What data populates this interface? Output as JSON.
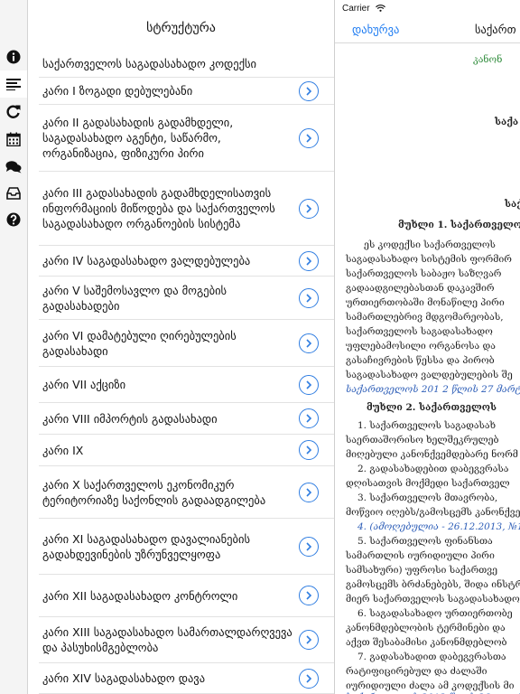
{
  "status_bar": {
    "carrier": "Carrier"
  },
  "rail": {
    "items": [
      {
        "icon": "info-icon"
      },
      {
        "icon": "structure-icon",
        "active": true
      },
      {
        "icon": "refresh-icon"
      },
      {
        "icon": "calendar-icon"
      },
      {
        "icon": "comments-icon"
      },
      {
        "icon": "inbox-icon"
      },
      {
        "icon": "help-icon"
      }
    ]
  },
  "panel": {
    "title": "სტრუქტურა",
    "items": [
      {
        "label": "საქართველოს საგადასახადო კოდექსი",
        "chevron": false
      },
      {
        "label": "კარი I ზოგადი დებულებანი",
        "chevron": true
      },
      {
        "label": "კარი II გადასახადის გადამხდელი, საგადასახადო აგენტი, საწარმო, ორგანიზაცია, ფიზიკური პირი",
        "chevron": true
      },
      {
        "label": "კარი III გადასახადის გადამხდელისათვის ინფორმაციის მიწოდება და საქართველოს საგადასახადო ორგანოების სისტემა",
        "chevron": true
      },
      {
        "label": "კარი IV საგადასახადო ვალდებულება",
        "chevron": true
      },
      {
        "label": "კარი V საშემოსავლო და მოგების გადასახადები",
        "chevron": true
      },
      {
        "label": "კარი VI დამატებული ღირებულების გადასახადი",
        "chevron": true
      },
      {
        "label": "კარი VII აქციზი",
        "chevron": true
      },
      {
        "label": "კარი VIII იმპორტის გადასახადი",
        "chevron": true
      },
      {
        "label": "კარი IX",
        "chevron": true
      },
      {
        "label": "კარი X საქართველოს ეკონომიკურ ტერიტორიაზე საქონლის გადაადგილება",
        "chevron": true
      },
      {
        "label": "კარი XI საგადასახადო დავალიანების გადახდევინების უზრუნველყოფა",
        "chevron": true
      },
      {
        "label": "კარი XII საგადასახადო კონტროლი",
        "chevron": true
      },
      {
        "label": "კარი XIII საგადასახადო სამართალდარღვევა და პასუხისმგებლობა",
        "chevron": true
      },
      {
        "label": "კარი XIV საგადასახადო დავა",
        "chevron": true
      }
    ]
  },
  "document": {
    "close_label": "დახურვა",
    "title": "საქართ",
    "lines": [
      {
        "text": "კანონ",
        "style": "green"
      },
      {
        "text": "საქა",
        "style": "bold"
      },
      {
        "text": "საქ",
        "style": "bold"
      },
      {
        "text": "მუხლი 1. საქართველოს",
        "style": "bold"
      },
      {
        "text": "ეს კოდექსი საქართველოს",
        "style": ""
      },
      {
        "text": "საგადასახადო სისტემის ფორმირ",
        "style": ""
      },
      {
        "text": "საქართველოს საბაჟო საზღვარ",
        "style": ""
      },
      {
        "text": "გადაადგილებასთან დაკავშირ",
        "style": ""
      },
      {
        "text": "ურთიერთობაში მონაწილე პირი",
        "style": ""
      },
      {
        "text": "სამართლებრივ მდგომარეობას,",
        "style": ""
      },
      {
        "text": "საქართველოს საგადასახადო",
        "style": ""
      },
      {
        "text": "უფლებამოსილი ორგანოსა და",
        "style": ""
      },
      {
        "text": "გასაჩივრების წესსა და პირობ",
        "style": ""
      },
      {
        "text": "საგადასახადო ვალდებულების შე",
        "style": ""
      },
      {
        "text": "საქართველოს 201 2 წლის 27 მარტის",
        "style": "blue"
      },
      {
        "text": "მუხლი 2. საქართველოს",
        "style": "bold"
      },
      {
        "text": "1. საქართველოს საგადასახ",
        "style": ""
      },
      {
        "text": "საერთაშორისო ხელშეკრულებ",
        "style": ""
      },
      {
        "text": "მიღებული კანონქვემდებარე ნორმ",
        "style": ""
      },
      {
        "text": "2. გადასახადებით დაბეგვრასა",
        "style": ""
      },
      {
        "text": "დღისათვის მოქმედი საქართველ",
        "style": ""
      },
      {
        "text": "3. საქართველოს მთავრობა,",
        "style": ""
      },
      {
        "text": "მოწვიო იღებს/გამოსცემს კანონქვე",
        "style": ""
      },
      {
        "text": "4. (ამოღებულია - 26.12.2013, №1",
        "style": "blue"
      },
      {
        "text": "5. საქართველოს ფინანსთა",
        "style": ""
      },
      {
        "text": "სამართლის იურიდიული პირი",
        "style": ""
      },
      {
        "text": "სამსახური) უფროსი საქართვე",
        "style": ""
      },
      {
        "text": "გამოსცემს ბრძანებებს, შიდა ინსტრ",
        "style": ""
      },
      {
        "text": "მიერ საქართველოს საგადასახადო",
        "style": ""
      },
      {
        "text": "6. საგადასახადო ურთიერთობე",
        "style": ""
      },
      {
        "text": "კანონმდებლობის ტერმინები და",
        "style": ""
      },
      {
        "text": "აქვთ შესაბამისი კანონმდებლობ",
        "style": ""
      },
      {
        "text": "7. გადასახადით დაბეგვრასთა",
        "style": ""
      },
      {
        "text": "რატიფიცირებულ და ძალაში",
        "style": ""
      },
      {
        "text": "იურიდიული ძალა ამ კოდექსის მი",
        "style": ""
      },
      {
        "text": "საქართველოს 2013 წლის 26 დეკემბ",
        "style": "blue"
      }
    ]
  }
}
